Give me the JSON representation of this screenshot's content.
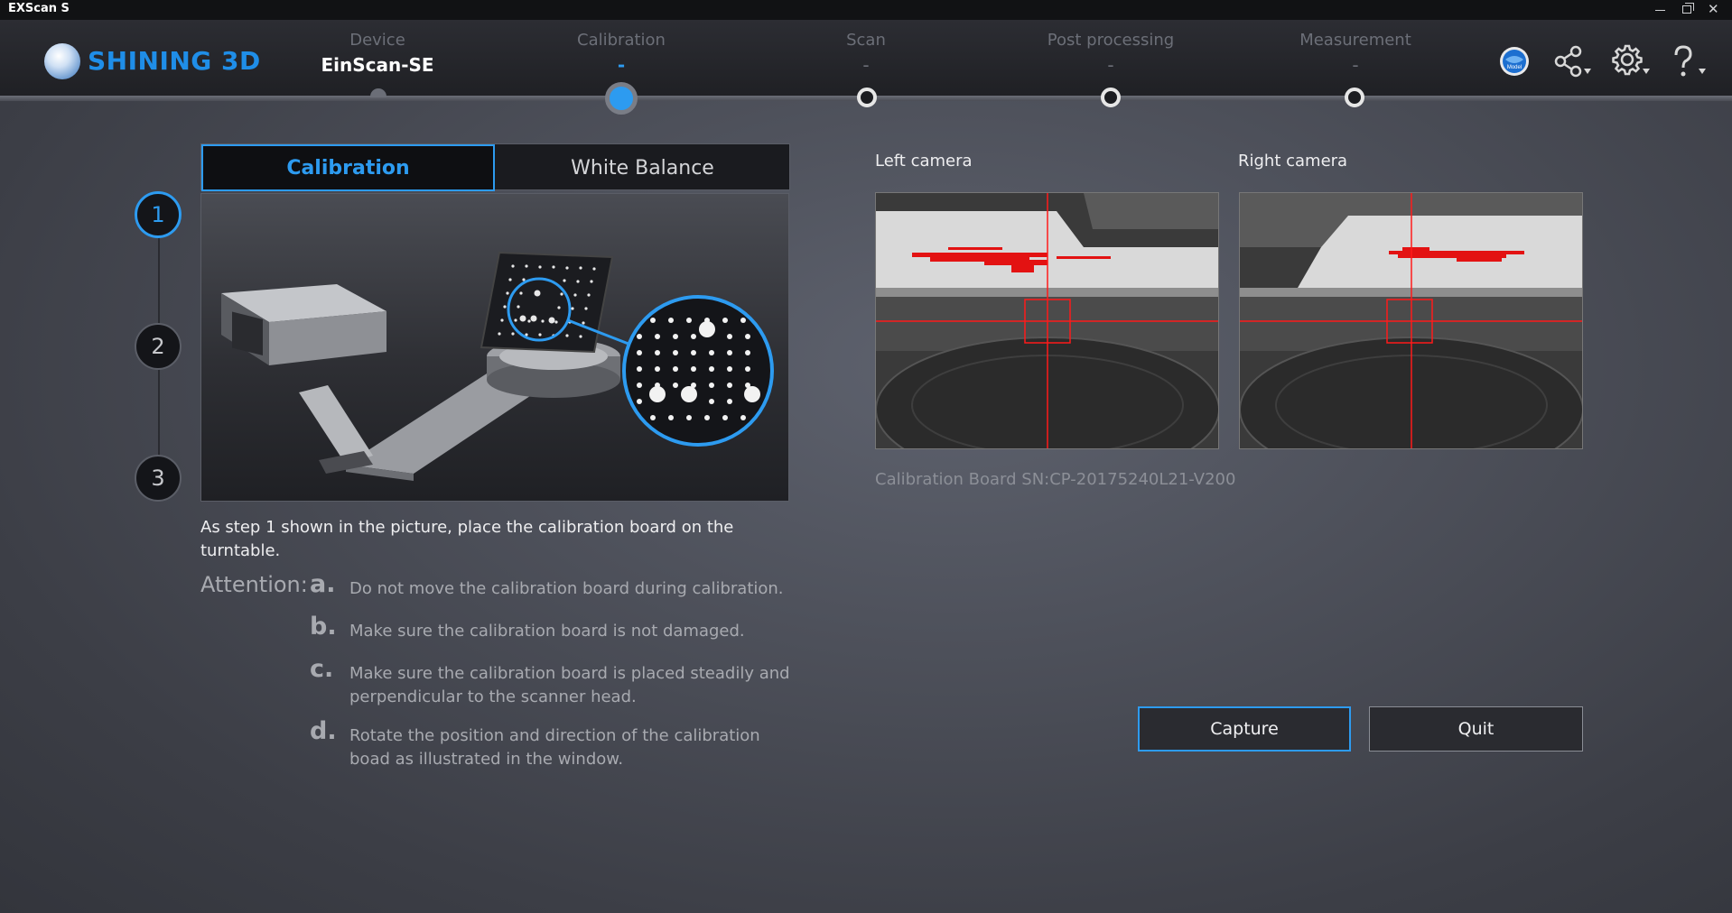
{
  "window": {
    "title": "EXScan S",
    "close_glyph": "✕"
  },
  "header": {
    "brand": "SHINING 3D",
    "steps": [
      {
        "label": "Device",
        "value": "EinScan-SE"
      },
      {
        "label": "Calibration",
        "value": "-"
      },
      {
        "label": "Scan",
        "value": "-"
      },
      {
        "label": "Post processing",
        "value": "-"
      },
      {
        "label": "Measurement",
        "value": "-"
      }
    ],
    "icons": [
      "ex-model-icon",
      "share-icon",
      "settings-icon",
      "help-icon"
    ]
  },
  "tabs": {
    "calibration": "Calibration",
    "white_balance": "White Balance"
  },
  "progress_steps": [
    "1",
    "2",
    "3"
  ],
  "instruction": "As step 1 shown in the picture, place the calibration board on the turntable.",
  "attention": {
    "label": "Attention:",
    "items": [
      {
        "letter": "a.",
        "text": "Do not move the calibration board during calibration."
      },
      {
        "letter": "b.",
        "text": "Make sure the calibration board is not damaged."
      },
      {
        "letter": "c.",
        "text": "Make sure the calibration board is placed steadily and perpendicular to the scanner head."
      },
      {
        "letter": "d.",
        "text": "Rotate the position and direction of the calibration boad as illustrated in the window."
      }
    ]
  },
  "cameras": {
    "left_label": "Left camera",
    "right_label": "Right camera"
  },
  "board_sn": "Calibration Board SN:CP-20175240L21-V200",
  "buttons": {
    "capture": "Capture",
    "quit": "Quit"
  },
  "colors": {
    "accent": "#2d9bf0",
    "crosshair": "#ff1a1a"
  }
}
